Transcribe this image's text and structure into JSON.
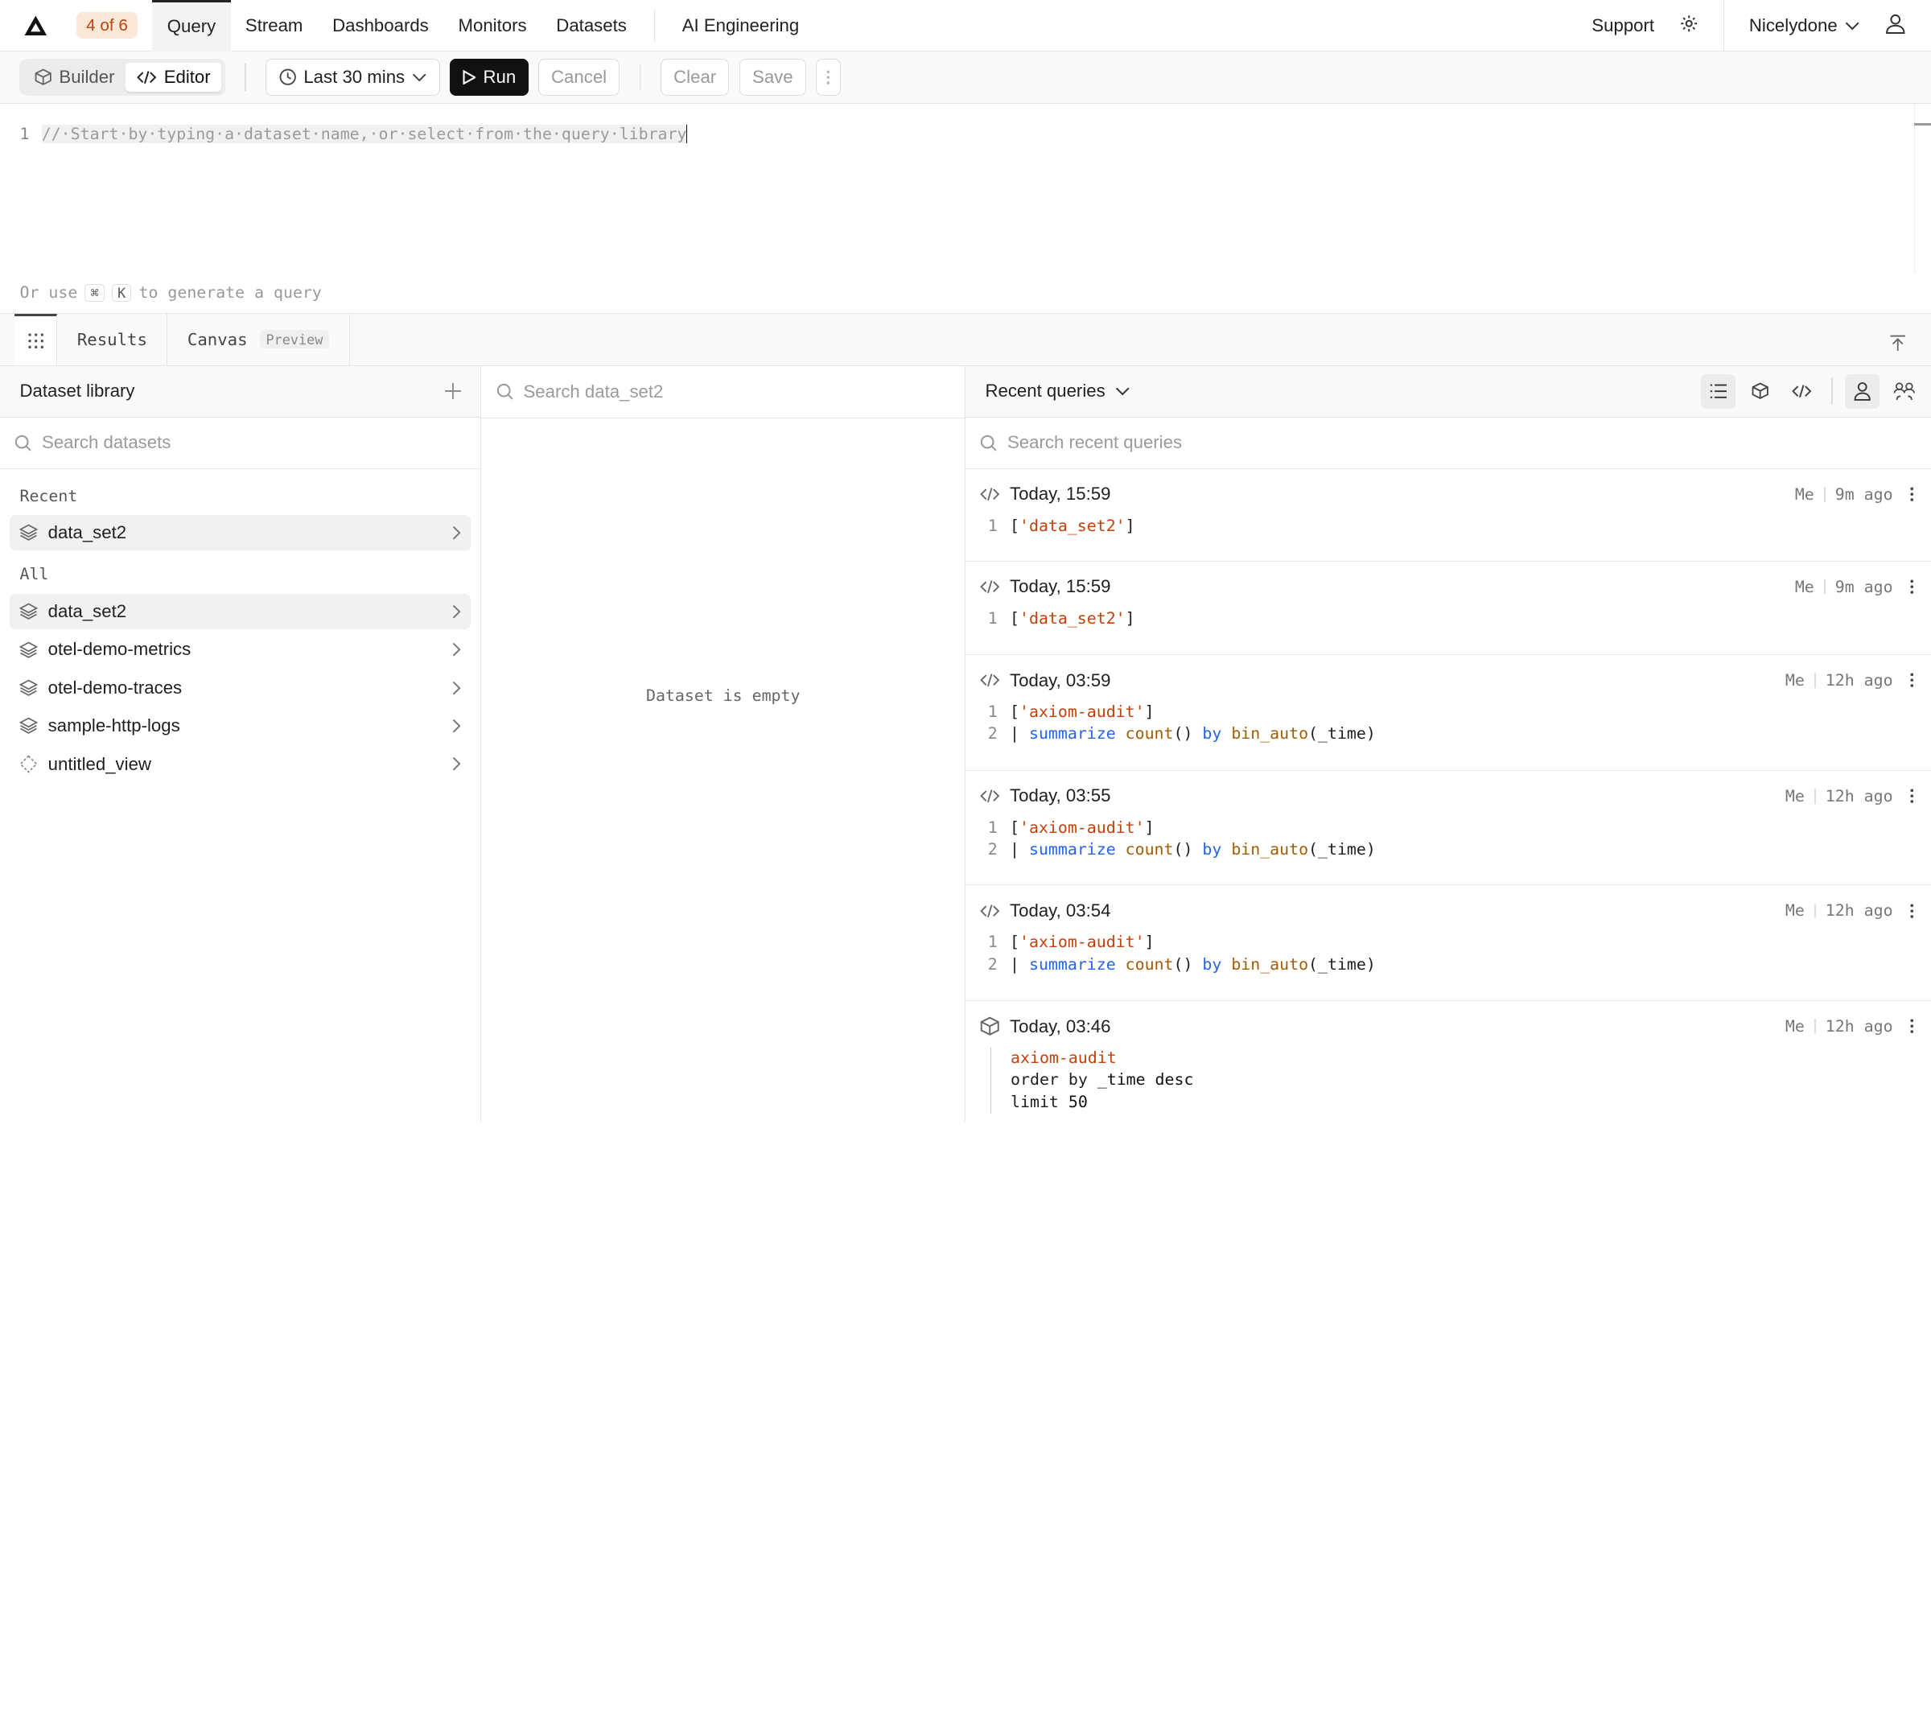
{
  "nav": {
    "badge": "4 of 6",
    "tabs": [
      "Query",
      "Stream",
      "Dashboards",
      "Monitors",
      "Datasets"
    ],
    "ai_tab": "AI Engineering",
    "support": "Support",
    "org": "Nicelydone"
  },
  "toolbar": {
    "builder": "Builder",
    "editor": "Editor",
    "time_range": "Last 30 mins",
    "run": "Run",
    "cancel": "Cancel",
    "clear": "Clear",
    "save": "Save"
  },
  "editor": {
    "line_no": "1",
    "placeholder": "//·Start·by·typing·a·dataset·name,·or·select·from·the·query·library",
    "hint_prefix": "Or use",
    "hint_key1": "⌘",
    "hint_key2": "K",
    "hint_suffix": "to generate a query"
  },
  "result_tabs": {
    "results": "Results",
    "canvas": "Canvas",
    "canvas_badge": "Preview"
  },
  "library": {
    "title": "Dataset library",
    "search_placeholder": "Search datasets",
    "recent_label": "Recent",
    "recent": [
      "data_set2"
    ],
    "all_label": "All",
    "all": [
      "data_set2",
      "otel-demo-metrics",
      "otel-demo-traces",
      "sample-http-logs",
      "untitled_view"
    ]
  },
  "dataset_panel": {
    "search_placeholder": "Search data_set2",
    "empty": "Dataset is empty"
  },
  "recent_queries": {
    "title": "Recent queries",
    "search_placeholder": "Search recent queries",
    "items": [
      {
        "time": "Today, 15:59",
        "who": "Me",
        "ago": "9m ago"
      },
      {
        "time": "Today, 15:59",
        "who": "Me",
        "ago": "9m ago"
      },
      {
        "time": "Today, 03:59",
        "who": "Me",
        "ago": "12h ago"
      },
      {
        "time": "Today, 03:55",
        "who": "Me",
        "ago": "12h ago"
      },
      {
        "time": "Today, 03:54",
        "who": "Me",
        "ago": "12h ago"
      },
      {
        "time": "Today, 03:46",
        "who": "Me",
        "ago": "12h ago"
      }
    ],
    "q1": {
      "ds": "'data_set2'"
    },
    "q2": {
      "ds": "'data_set2'"
    },
    "apl": {
      "ds": "'axiom-audit'",
      "pipe": "|",
      "summarize": "summarize",
      "count": "count",
      "by": "by",
      "bin": "bin_auto",
      "field": "(_time)"
    },
    "builder": {
      "ds": "axiom-audit",
      "order": "order",
      "by": "by",
      "order_field": "_time desc",
      "limit": "limit",
      "limit_val": "50"
    }
  },
  "colors": {
    "accent_orange": "#c2410c",
    "keyword_blue": "#2563eb",
    "badge_bg": "#fbe8d6"
  }
}
